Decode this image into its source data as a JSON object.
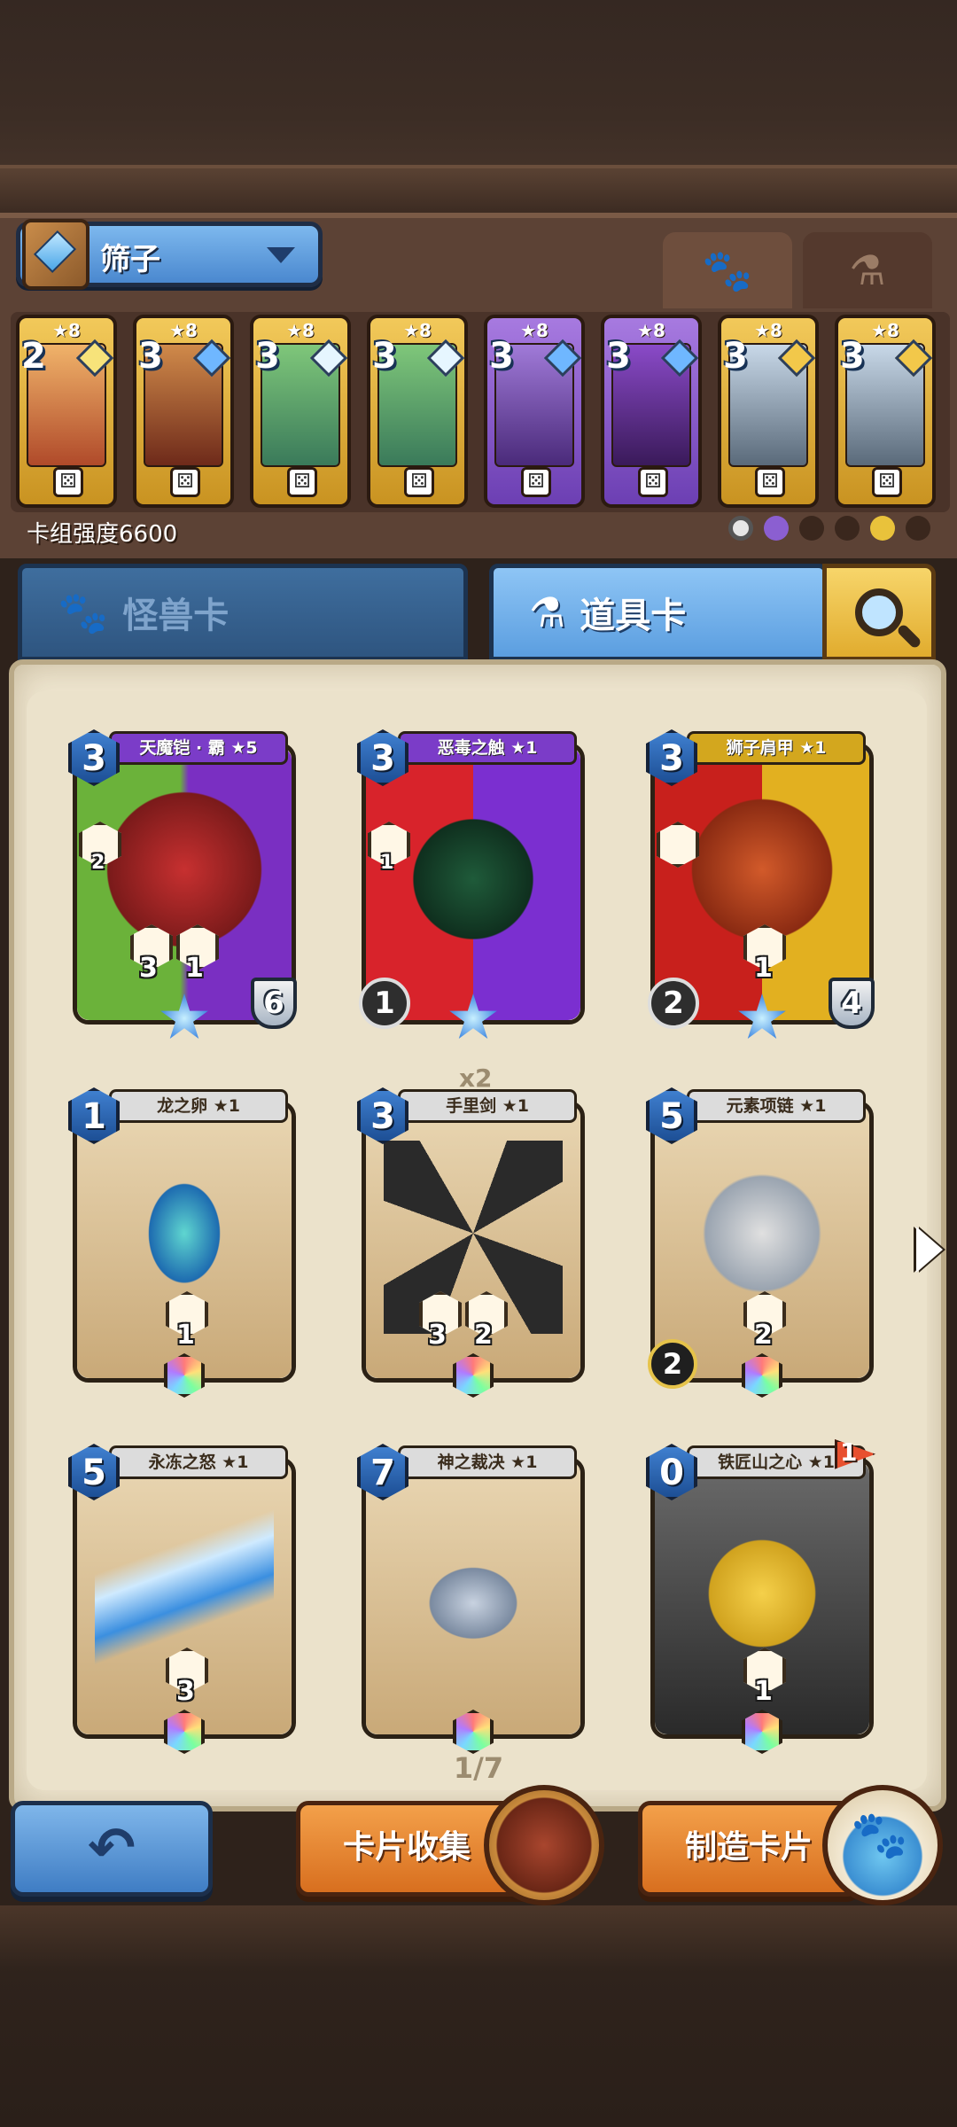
{
  "deck": {
    "name": "筛子",
    "strength_label": "卡组强度6600",
    "tabs": [
      {
        "id": "monster",
        "icon": "paw-icon",
        "active": true
      },
      {
        "id": "potion",
        "icon": "potion-icon",
        "active": false
      }
    ],
    "cards": [
      {
        "stars": "★8",
        "cost": "2",
        "gem": "rainbow",
        "color": "gold"
      },
      {
        "stars": "★8",
        "cost": "3",
        "gem": "blue",
        "color": "gold"
      },
      {
        "stars": "★8",
        "cost": "3",
        "gem": "ice",
        "color": "gold"
      },
      {
        "stars": "★8",
        "cost": "3",
        "gem": "ice",
        "color": "gold"
      },
      {
        "stars": "★8",
        "cost": "3",
        "gem": "blue",
        "color": "purple"
      },
      {
        "stars": "★8",
        "cost": "3",
        "gem": "blue",
        "color": "purple"
      },
      {
        "stars": "★8",
        "cost": "3",
        "gem": "gold",
        "color": "gold"
      },
      {
        "stars": "★8",
        "cost": "3",
        "gem": "gold",
        "color": "gold"
      }
    ]
  },
  "categories": {
    "monster_label": "怪兽卡",
    "item_label": "道具卡",
    "active": "item"
  },
  "cards": [
    {
      "name": "天魔铠 · 霸 ★5",
      "cost": "3",
      "stat_left": "2",
      "mid_a": "3",
      "mid_b": "1",
      "shield": "6",
      "theme": "purple-green"
    },
    {
      "name": "恶毒之触 ★1",
      "cost": "3",
      "stat_left": "1",
      "sword": "1",
      "theme": "red-purple"
    },
    {
      "name": "狮子肩甲 ★1",
      "cost": "3",
      "stat_left": "",
      "mid_b": "1",
      "sword": "2",
      "shield": "4",
      "theme": "red-gold"
    },
    {
      "name": "龙之卵 ★1",
      "cost": "1",
      "mid_b": "1",
      "theme": "parchment"
    },
    {
      "name": "手里剑 ★1",
      "cost": "3",
      "copies": "x2",
      "mid_a": "3",
      "mid_b": "2",
      "theme": "parchment"
    },
    {
      "name": "元素项链 ★1",
      "cost": "5",
      "mid_b": "2",
      "bolt": "2",
      "theme": "parchment"
    },
    {
      "name": "永冻之怒 ★1",
      "cost": "5",
      "mid_b": "3",
      "theme": "parchment"
    },
    {
      "name": "神之裁决 ★1",
      "cost": "7",
      "theme": "parchment"
    },
    {
      "name": "铁匠山之心 ★1",
      "cost": "0",
      "mid_b": "1",
      "flag": "1",
      "theme": "dark"
    }
  ],
  "pagination": {
    "label": "1/7"
  },
  "buttons": {
    "collect": "卡片收集",
    "craft": "制造卡片"
  },
  "colors": {
    "blue_button": "#4a88cf",
    "orange_button": "#e07a26",
    "parchment": "#efe6d0"
  }
}
